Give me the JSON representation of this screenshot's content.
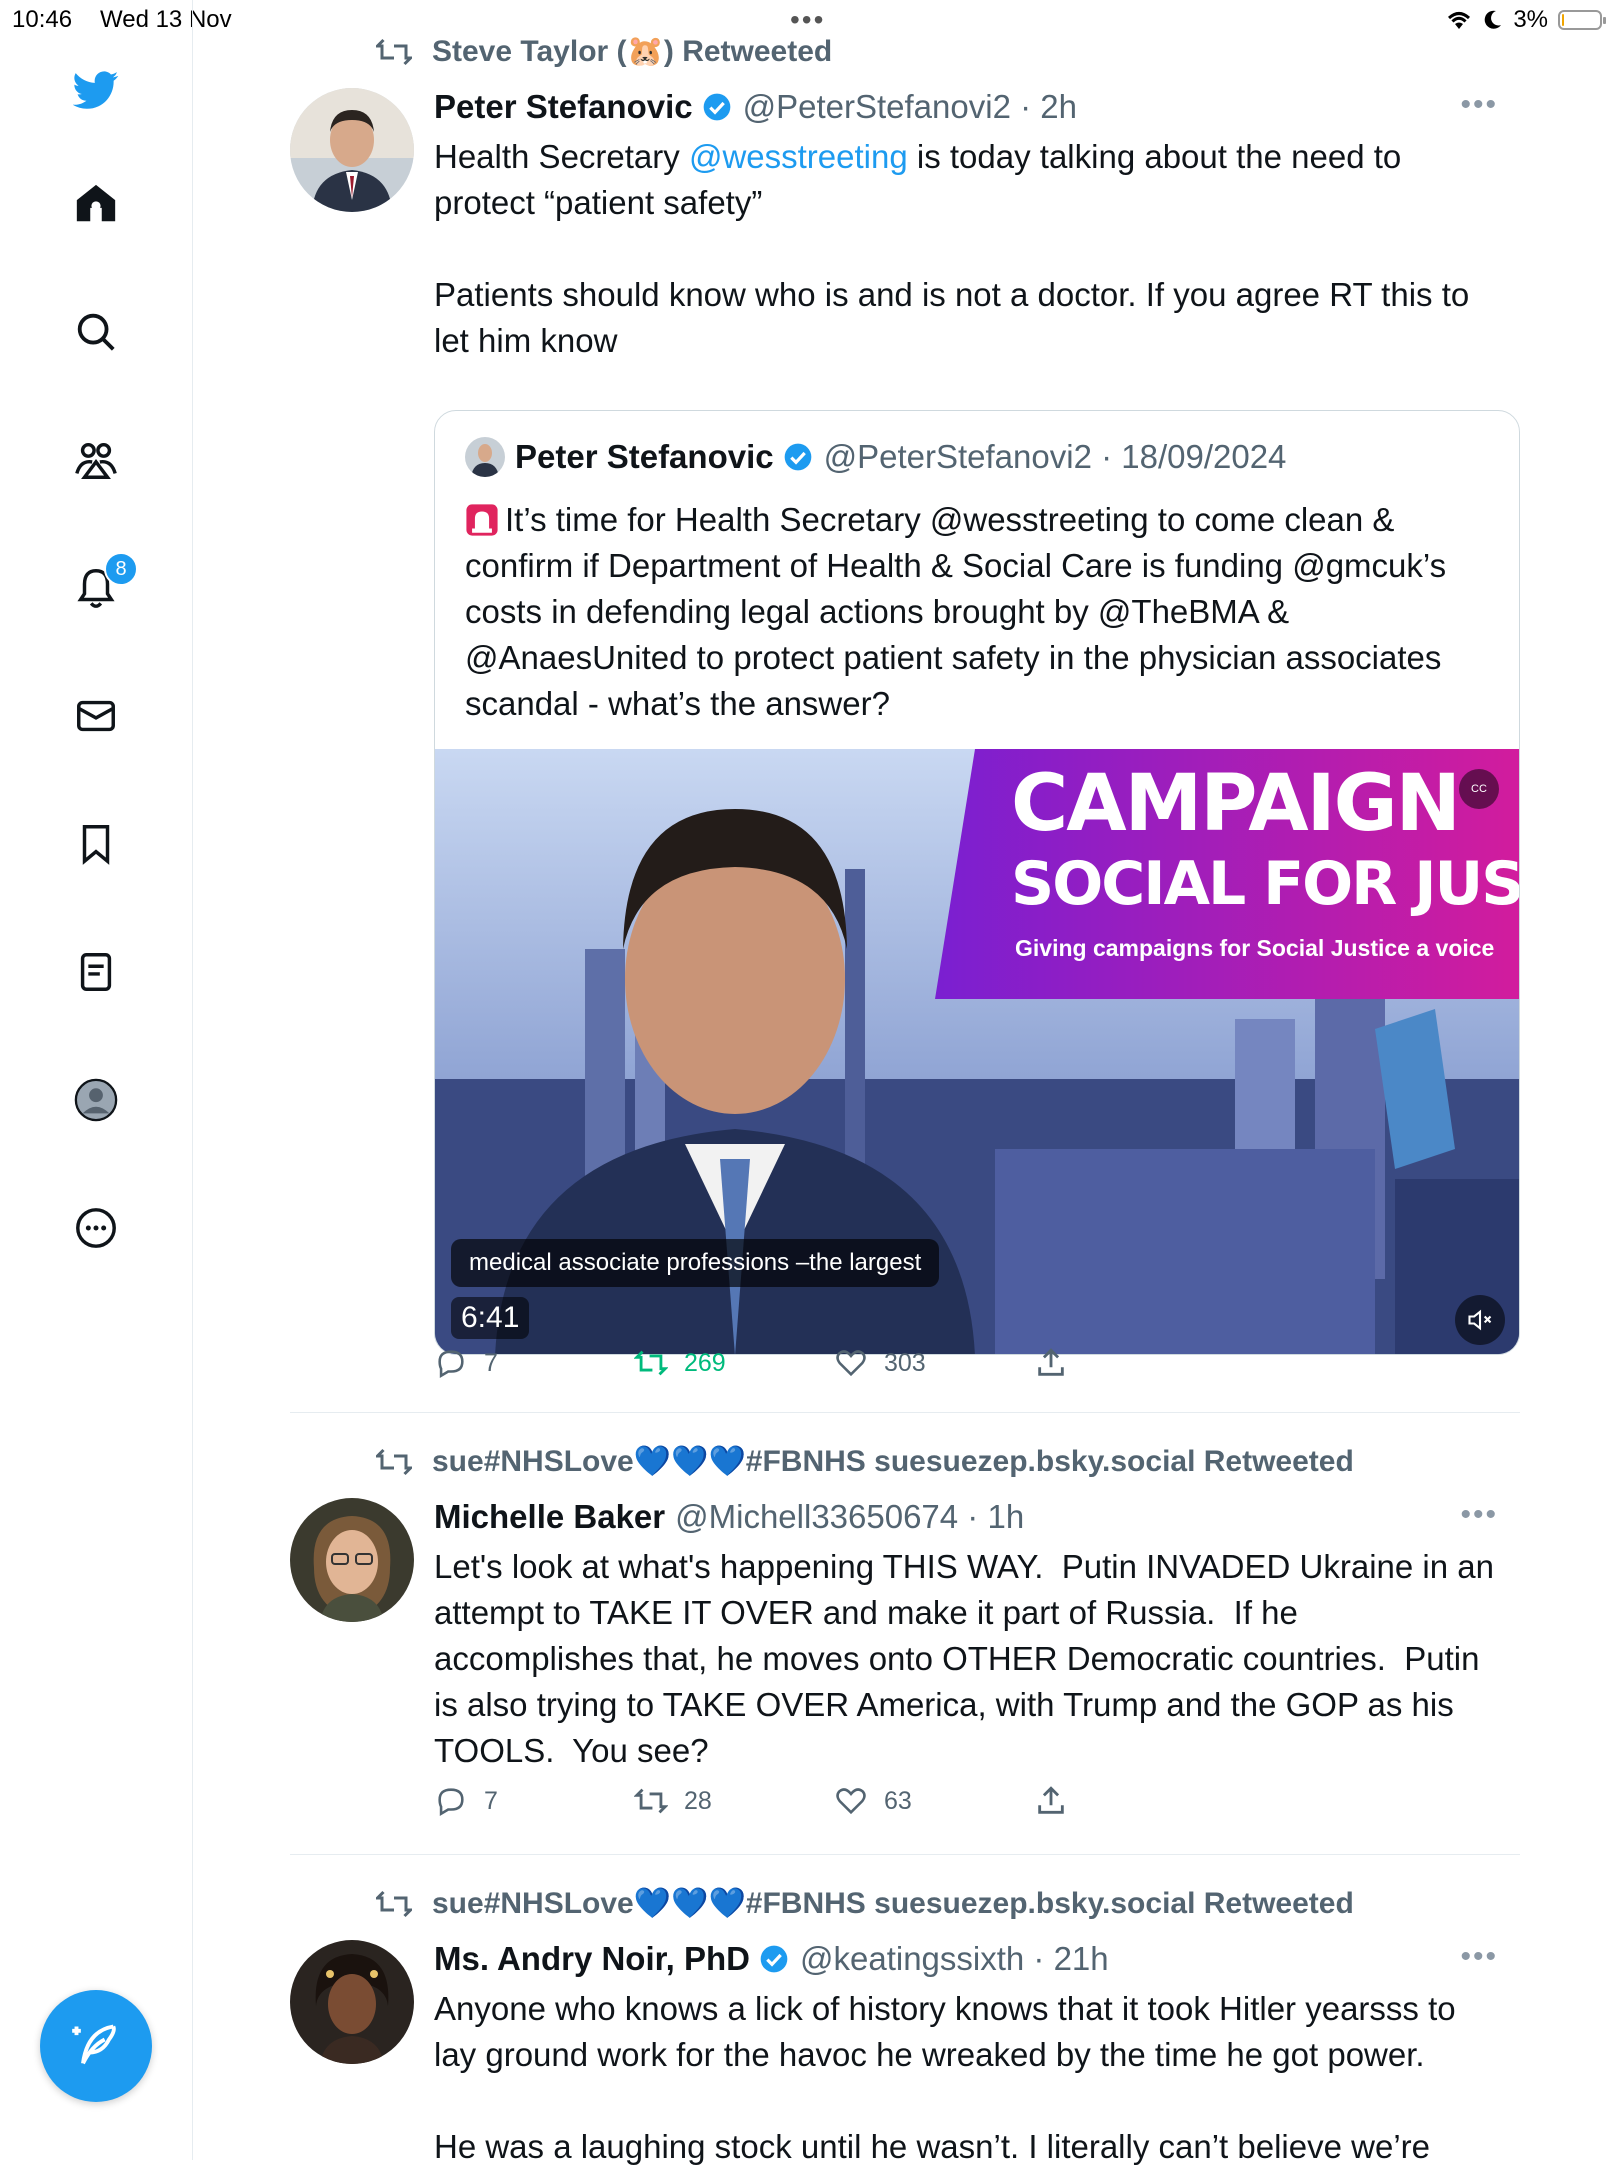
{
  "status_bar": {
    "time": "10:46",
    "date": "Wed 13 Nov",
    "battery": "3%",
    "battery_level": 0.03
  },
  "sidebar": {
    "items": [
      {
        "name": "home"
      },
      {
        "name": "explore"
      },
      {
        "name": "communities"
      },
      {
        "name": "notifications",
        "badge": "8"
      },
      {
        "name": "messages"
      },
      {
        "name": "bookmarks"
      },
      {
        "name": "lists"
      },
      {
        "name": "profile"
      },
      {
        "name": "more"
      }
    ]
  },
  "tweets": [
    {
      "retweeted_by": "Steve Taylor (🐹) Retweeted",
      "name": "Peter Stefanovic",
      "handle": "@PeterStefanovi2 · 2h",
      "text_before": "Health Secretary ",
      "mention": "@wesstreeting",
      "text_after": " is today talking about the need to protect “patient safety”\n\nPatients should know who is and is not a doctor. If you agree RT this to let him know",
      "quote": {
        "name": "Peter Stefanovic",
        "handle": "@PeterStefanovi2 · 18/09/2024",
        "text": "It’s time for Health Secretary @wesstreeting to come clean & confirm if Department of Health & Social Care is funding @gmcuk’s costs in defending legal actions brought by @TheBMA & @AnaesUnited to protect patient safety in the physician associates scandal - what’s the answer?",
        "video": {
          "banner_title": "CAMPAIGN",
          "banner_sub": "SOCIAL FOR JUSTICE",
          "banner_tag": "Giving campaigns for Social Justice a voice",
          "caption": "medical associate professions –the largest",
          "duration": "6:41",
          "cc": "CC"
        }
      },
      "replies": "7",
      "retweets": "269",
      "likes": "303"
    },
    {
      "retweeted_by": "sue#NHSLove💙💙💙#FBNHS suesuezep.bsky.social Retweeted",
      "name": "Michelle Baker",
      "handle": "@Michell33650674 · 1h",
      "text": "Let's look at what's happening THIS WAY.  Putin INVADED Ukraine in an attempt to TAKE IT OVER and make it part of Russia.  If he accomplishes that, he moves onto OTHER Democratic countries.  Putin is also trying to TAKE OVER America, with Trump and the GOP as his TOOLS.  You see?",
      "replies": "7",
      "retweets": "28",
      "likes": "63"
    },
    {
      "retweeted_by": "sue#NHSLove💙💙💙#FBNHS suesuezep.bsky.social Retweeted",
      "name": "Ms. Andry Noir, PhD",
      "handle": "@keatingssixth · 21h",
      "text": "Anyone who knows a lick of history knows that it took Hitler yearsss to lay ground work for the havoc he wreaked by the time he got power.\n\nHe was a laughing stock until he wasn’t. I literally can’t believe we’re"
    }
  ],
  "colors": {
    "accent": "#1d9bf0",
    "retweet_green": "#00ba7c",
    "muted": "#536471"
  }
}
